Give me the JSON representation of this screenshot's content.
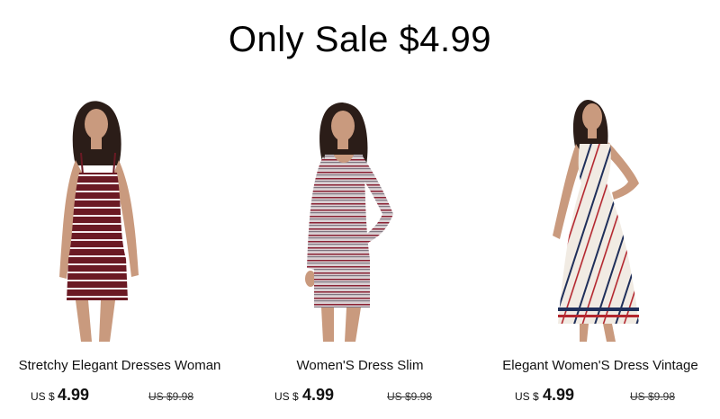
{
  "banner": {
    "title": "Only Sale $4.99"
  },
  "products": [
    {
      "title": "Stretchy Elegant Dresses Woman",
      "currency": "US $",
      "price": "4.99",
      "original_price": "US $9.98",
      "image": "burgundy-striped-slip-dress"
    },
    {
      "title": "Women'S Dress Slim",
      "currency": "US $",
      "price": "4.99",
      "original_price": "US $9.98",
      "image": "grey-striped-long-sleeve-dress"
    },
    {
      "title": "Elegant Women'S Dress Vintage",
      "currency": "US $",
      "price": "4.99",
      "original_price": "US $9.98",
      "image": "white-striped-maxi-slip-dress"
    }
  ],
  "colors": {
    "text": "#111111",
    "dress_1": "#6b1a24",
    "dress_2": "#c8bcc0",
    "dress_3": "#f1ebe3"
  }
}
